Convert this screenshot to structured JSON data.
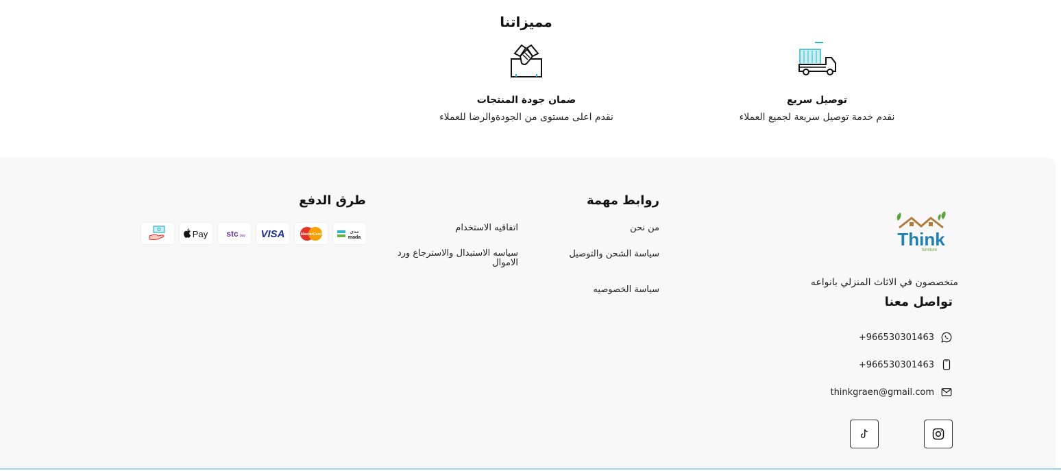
{
  "features": {
    "title": "مميزاتنا",
    "items": [
      {
        "title": "توصيل سريع",
        "desc": "نقدم خدمة توصيل سريعة لجميع العملاء",
        "icon": "delivery-truck-icon"
      },
      {
        "title": "ضمان جودة المنتجات",
        "desc": "نقدم اعلى مستوى من الجودةوالرضا للعملاء",
        "icon": "handshake-icon"
      }
    ]
  },
  "brand": {
    "logo_text": "Think",
    "logo_subtext": "furniture",
    "tagline": "متخصصون في الاثاث المنزلي بانواعه"
  },
  "contact": {
    "title": "تواصل معنا",
    "whatsapp": "+966530301463",
    "phone": "+966530301463",
    "email": "thinkgraen@gmail.com"
  },
  "links": {
    "title": "روابط مهمة",
    "items": [
      "من نحن",
      "اتفاقيه الاستخدام",
      "سياسة الشحن والتوصيل",
      "سياسه الاستبدال والاسترجاع ورد الاموال",
      "سياسة الخصوصيه"
    ]
  },
  "payments": {
    "title": "طرق الدفع",
    "methods": [
      {
        "name": "mada",
        "label_ar": "مدى",
        "label_en": "mada"
      },
      {
        "name": "mastercard",
        "label": "MasterCard"
      },
      {
        "name": "visa",
        "label": "VISA"
      },
      {
        "name": "stcpay",
        "label": "stc",
        "label_small": "pay"
      },
      {
        "name": "applepay",
        "label": "Pay"
      },
      {
        "name": "cash",
        "label": ""
      }
    ]
  },
  "colors": {
    "teal": "#2bb5c7",
    "logo_blue": "#1d7fb8",
    "logo_roof": "#b47a3a",
    "logo_leaf": "#5aa43a",
    "footer_bg": "#f8f8f8"
  }
}
